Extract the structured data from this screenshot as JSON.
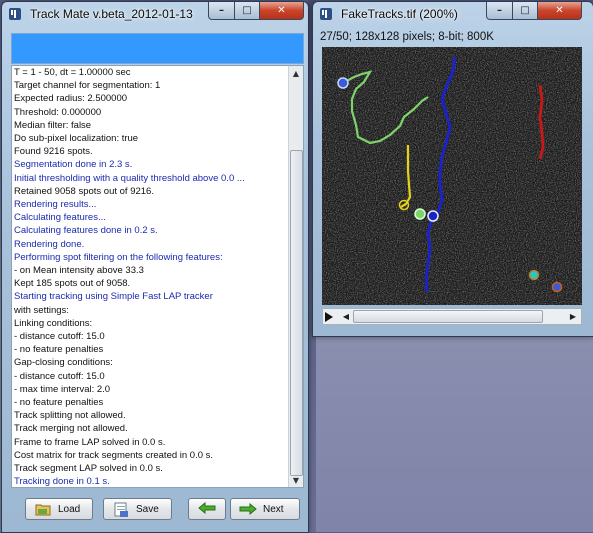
{
  "trackmate": {
    "title": "Track Mate v.beta_2012-01-13",
    "log": [
      {
        "text": "T =    1 -   50, dt = 1.00000 sec",
        "color": "black"
      },
      {
        "text": "  Target channel for segmentation: 1",
        "color": "black"
      },
      {
        "text": "  Expected radius: 2.500000",
        "color": "black"
      },
      {
        "text": "  Threshold: 0.000000",
        "color": "black"
      },
      {
        "text": "  Median filter: false",
        "color": "black"
      },
      {
        "text": "  Do sub-pixel localization: true",
        "color": "black"
      },
      {
        "text": "Found 9216 spots.",
        "color": "black"
      },
      {
        "text": "Segmentation done in 2.3 s.",
        "color": "blue"
      },
      {
        "text": "Initial thresholding with a quality threshold above 0.0 ...",
        "color": "blue"
      },
      {
        "text": "Retained 9058 spots out of 9216.",
        "color": "black"
      },
      {
        "text": "Rendering results...",
        "color": "blue"
      },
      {
        "text": "Calculating features...",
        "color": "blue"
      },
      {
        "text": "Calculating features done in 0.2 s.",
        "color": "blue"
      },
      {
        "text": "Rendering done.",
        "color": "blue"
      },
      {
        "text": "Performing spot filtering on the following features:",
        "color": "blue"
      },
      {
        "text": "  - on Mean intensity above 33.3",
        "color": "black"
      },
      {
        "text": "Kept 185 spots out of 9058.",
        "color": "black"
      },
      {
        "text": "Starting tracking using Simple Fast LAP tracker",
        "color": "blue"
      },
      {
        "text": "with settings:",
        "color": "black"
      },
      {
        "text": "  Linking conditions:",
        "color": "black"
      },
      {
        "text": "    - distance cutoff: 15.0",
        "color": "black"
      },
      {
        "text": "    - no feature penalties",
        "color": "black"
      },
      {
        "text": "  Gap-closing conditions:",
        "color": "black"
      },
      {
        "text": "    - distance cutoff: 15.0",
        "color": "black"
      },
      {
        "text": "    - max time interval: 2.0",
        "color": "black"
      },
      {
        "text": "    - no feature penalties",
        "color": "black"
      },
      {
        "text": "  Track splitting not allowed.",
        "color": "black"
      },
      {
        "text": "  Track merging not allowed.",
        "color": "black"
      },
      {
        "text": "  Frame to frame LAP solved in 0.0 s.",
        "color": "black"
      },
      {
        "text": "  Cost matrix for track segments created in 0.0 s.",
        "color": "black"
      },
      {
        "text": "  Track segment LAP solved in 0.0 s.",
        "color": "black"
      },
      {
        "text": "Tracking done in 0.1 s.",
        "color": "blue"
      }
    ],
    "buttons": {
      "load": "Load",
      "save": "Save",
      "next": "Next"
    },
    "window_controls": {
      "minimize": "–",
      "maximize": "□",
      "close": "✕"
    }
  },
  "image_window": {
    "title": "FakeTracks.tif (200%)",
    "info": "27/50; 128x128 pixels; 8-bit; 800K",
    "window_controls": {
      "minimize": "–",
      "maximize": "□",
      "close": "✕"
    }
  },
  "icons": {
    "load": "load-icon",
    "save": "save-icon",
    "back": "back-arrow-icon",
    "next": "next-arrow-icon",
    "imagej": "imagej-icon"
  },
  "colors": {
    "log_black": "#111111",
    "log_blue": "#1a2bb0",
    "blue_bar": "#3399ff",
    "track_green": "#7fd36b",
    "track_blue": "#1a22c8",
    "track_yellow": "#e6d21a",
    "track_red": "#c81818"
  }
}
